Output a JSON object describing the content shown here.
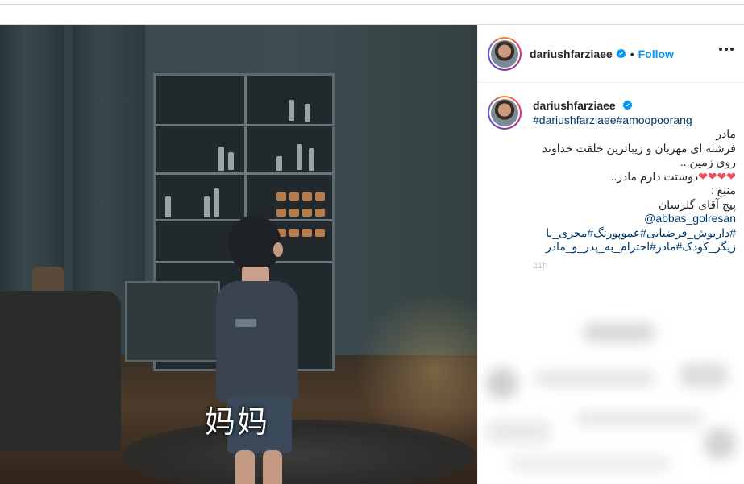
{
  "post": {
    "media": {
      "subtitle": "妈妈"
    },
    "header": {
      "username": "dariushfarziaee",
      "dot": "•",
      "follow_label": "Follow"
    },
    "caption": {
      "username": "dariushfarziaee",
      "hashtags_line": "#dariushfarziaee#amoopoorang",
      "lines": [
        "مادر",
        "فرشته ای مهربان و زیباترین خلقت خداوند",
        "روی زمین...",
        "دوستت دارم مادر..."
      ],
      "hearts": "❤❤❤❤",
      "source_label": "منبع :",
      "source_name": "پیج آقای گلرسان",
      "mention": "@abbas_golresan",
      "tags_line1": "#داریوش_فرضیایی#عموپورنگ#مجری_با",
      "tags_line2": "زیگر_کودک#مادر#احترام_به_پدر_و_مادر",
      "time_hint": "21h"
    },
    "colors": {
      "link": "#0095f6",
      "hashtag": "#00376b",
      "heart": "#ed4956",
      "verified": "#0095f6"
    }
  }
}
